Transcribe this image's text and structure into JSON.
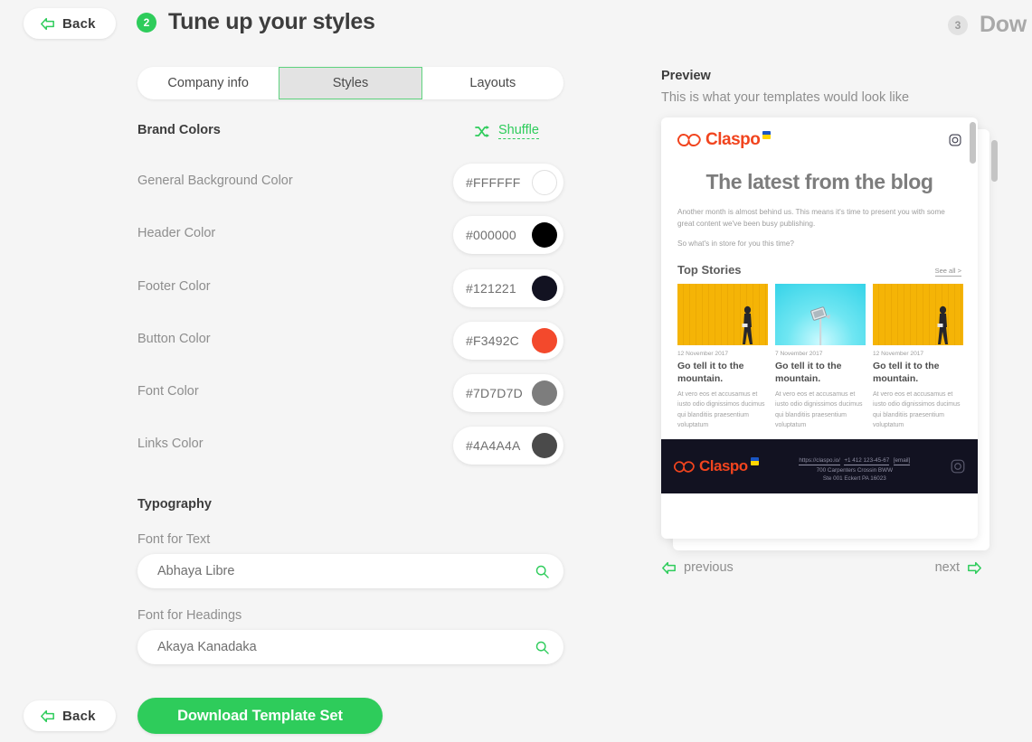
{
  "topbar": {
    "back_label": "Back",
    "back_icon": "arrow-left-icon",
    "step_current": "2",
    "step_current_title": "Tune up your styles",
    "step_next": "3",
    "step_next_title": "Dow"
  },
  "tabs": [
    {
      "label": "Company info",
      "active": false
    },
    {
      "label": "Styles",
      "active": true
    },
    {
      "label": "Layouts",
      "active": false
    }
  ],
  "brand_colors": {
    "heading": "Brand Colors",
    "shuffle_label": "Shuffle",
    "shuffle_icon": "shuffle-icon",
    "rows": [
      {
        "label": "General Background Color",
        "hex": "#FFFFFF"
      },
      {
        "label": "Header Color",
        "hex": "#000000"
      },
      {
        "label": "Footer Color",
        "hex": "#121221"
      },
      {
        "label": "Button Color",
        "hex": "#F3492C"
      },
      {
        "label": "Font Color",
        "hex": "#7D7D7D"
      },
      {
        "label": "Links Color",
        "hex": "#4A4A4A"
      }
    ]
  },
  "typography": {
    "heading": "Typography",
    "text_font_label": "Font for Text",
    "text_font_value": "Abhaya Libre",
    "heading_font_label": "Font for Headings",
    "heading_font_value": "Akaya Kanadaka",
    "search_icon": "search-icon"
  },
  "footer_actions": {
    "back_label": "Back",
    "download_label": "Download Template Set"
  },
  "preview": {
    "title": "Preview",
    "subtitle": "This is what your templates would look like",
    "prev_label": "previous",
    "next_label": "next",
    "prev_icon": "arrow-left-icon",
    "next_icon": "arrow-right-icon"
  },
  "email": {
    "logo_text": "Claspo",
    "logo_icon": "claspo-cloud-icon",
    "instagram_icon": "instagram-icon",
    "headline": "The latest from the blog",
    "paragraph_1": "Another month is almost behind us. This means it's time to present you with some great content we've been busy publishing.",
    "paragraph_2": "So what's in store for you this time?",
    "stories_heading": "Top Stories",
    "see_all_label": "See all >",
    "cards": [
      {
        "date": "12 November 2017",
        "title": "Go tell it to the mountain.",
        "body": "At vero eos et accusamus et iusto odio dignissimos ducimus qui blanditiis praesentium voluptatum",
        "image": "yellow-wall-walking-person"
      },
      {
        "date": "7 November 2017",
        "title": "Go tell it to the mountain.",
        "body": "At vero eos et accusamus et iusto odio dignissimos ducimus qui blanditiis praesentium voluptatum",
        "image": "cyan-sky-floodlight"
      },
      {
        "date": "12 November 2017",
        "title": "Go tell it to the mountain.",
        "body": "At vero eos et accusamus et iusto odio dignissimos ducimus qui blanditiis praesentium voluptatum",
        "image": "yellow-wall-walking-person"
      }
    ],
    "footer": {
      "logo_text": "Claspo",
      "url": "https://claspo.io/",
      "phone": "+1 412 123-45-67",
      "email": "[email]",
      "address_line_1": "700 Carpenters Crossin BWW",
      "address_line_2": "Ste 001 Eckert PA 16023",
      "instagram_icon": "instagram-icon"
    }
  },
  "colors": {
    "accent_green": "#2ECC5B",
    "brand_orange": "#F1441E",
    "footer_dark": "#121221",
    "page_bg": "#F5F5F5"
  }
}
